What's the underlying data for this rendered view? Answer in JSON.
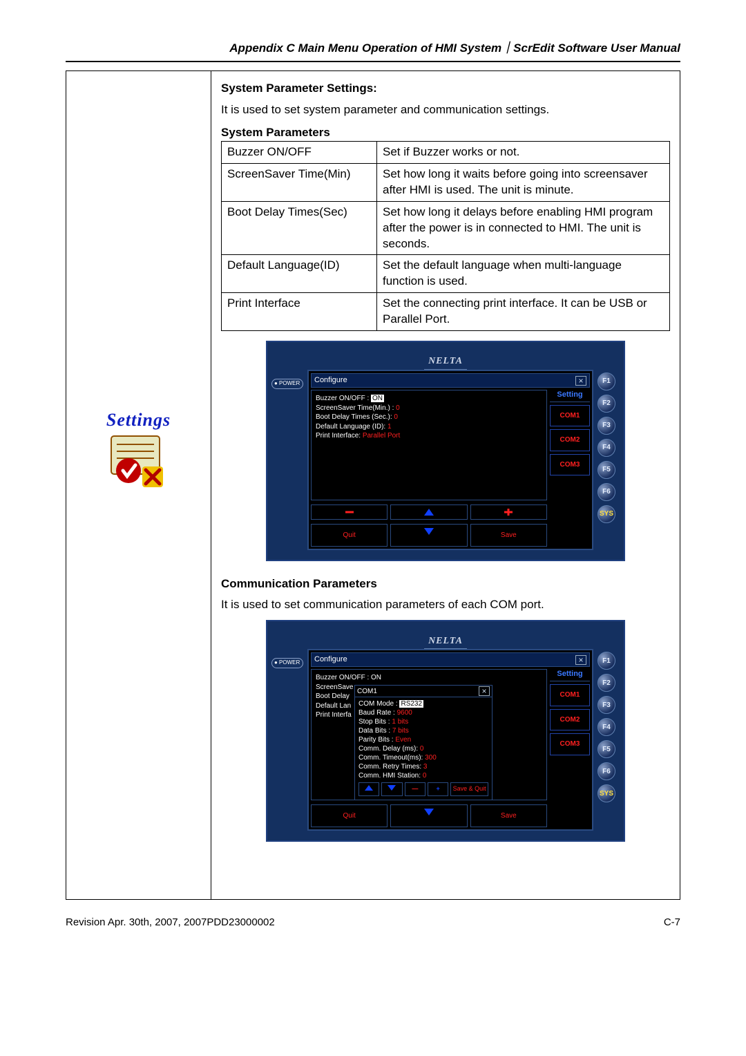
{
  "header": "Appendix C  Main Menu Operation of HMI System｜ScrEdit Software User Manual",
  "settings_label": "Settings",
  "section1": {
    "title": "System Parameter Settings:",
    "para": "It is used to set system parameter and communication settings.",
    "subtitle": "System Parameters",
    "rows": [
      {
        "k": "Buzzer ON/OFF",
        "v": "Set if Buzzer works or not."
      },
      {
        "k": "ScreenSaver Time(Min)",
        "v": "Set how long it waits before going into screensaver after HMI is used. The unit is minute."
      },
      {
        "k": "Boot Delay Times(Sec)",
        "v": "Set how long it delays before enabling HMI program after the power is in connected to HMI. The unit is seconds."
      },
      {
        "k": "Default Language(ID)",
        "v": "Set the default language when multi-language function is used."
      },
      {
        "k": "Print Interface",
        "v": "Set the connecting print interface. It can be USB or Parallel Port."
      }
    ]
  },
  "section2": {
    "title": "Communication Parameters",
    "para": "It is used to set communication parameters of each COM port."
  },
  "device": {
    "brand": "NELTA",
    "power": "● POWER",
    "configure": "Configure",
    "setting": "Setting",
    "com": [
      "COM1",
      "COM2",
      "COM3"
    ],
    "fkeys": [
      "F1",
      "F2",
      "F3",
      "F4",
      "F5",
      "F6",
      "SYS"
    ],
    "quit": "Quit",
    "save": "Save",
    "save_quit": "Save & Quit"
  },
  "screen1_lines": {
    "l1a": "Buzzer ON/OFF : ",
    "l1b": "ON",
    "l2a": "ScreenSaver Time(Min.) : ",
    "l2b": "0",
    "l3a": "Boot Delay Times (Sec.): ",
    "l3b": "0",
    "l4a": "Default Language (ID): ",
    "l4b": "1",
    "l5a": "Print Interface: ",
    "l5b": "Parallel Port"
  },
  "screen2_back": {
    "l1": "Buzzer ON/OFF : ON",
    "l2": "ScreenSave",
    "l3": "Boot Delay",
    "l4": "Default Lan",
    "l5": "Print Interfa"
  },
  "screen2_sub": {
    "title": "COM1",
    "l1a": "COM Mode : ",
    "l1b": "RS232",
    "l2a": "Baud Rate : ",
    "l2b": "9600",
    "l3a": "Stop Bits : ",
    "l3b": "1 bits",
    "l4a": "Data Bits : ",
    "l4b": "7 bits",
    "l5a": "Parity Bits : ",
    "l5b": "Even",
    "l6a": "Comm. Delay (ms): ",
    "l6b": "0",
    "l7a": "Comm. Timeout(ms): ",
    "l7b": "300",
    "l8a": "Comm. Retry Times: ",
    "l8b": "3",
    "l9a": "Comm. HMI Station: ",
    "l9b": "0"
  },
  "footer": {
    "left": "Revision Apr. 30th, 2007, 2007PDD23000002",
    "right": "C-7"
  }
}
